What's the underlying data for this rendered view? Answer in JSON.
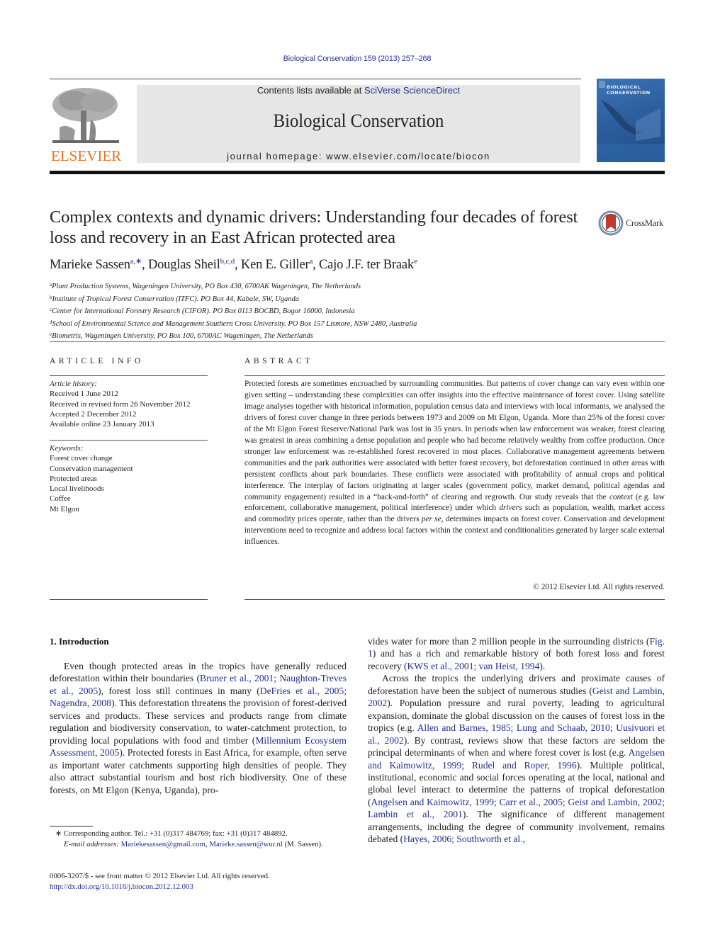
{
  "header": {
    "citation": "Biological Conservation 159 (2013) 257–268",
    "contents_prefix": "Contents lists available at ",
    "contents_link": "SciVerse ScienceDirect",
    "journal_name": "Biological Conservation",
    "homepage": "journal homepage: www.elsevier.com/locate/biocon",
    "publisher_logo": "ELSEVIER",
    "cover_title_line1": "BIOLOGICAL",
    "cover_title_line2": "CONSERVATION",
    "crossmark": "CrossMark"
  },
  "colors": {
    "link": "#1f2f8f",
    "elsevier_orange": "#e8731d",
    "banner_gray": "#e6e6e6",
    "cover_blue": "#2d5f9f",
    "crossmark_red": "#c0392b"
  },
  "article": {
    "title": "Complex contexts and dynamic drivers: Understanding four decades of forest loss and recovery in an East African protected area",
    "authors": [
      {
        "name": "Marieke Sassen",
        "sup": "a,∗"
      },
      {
        "name": "Douglas Sheil",
        "sup": "b,c,d"
      },
      {
        "name": "Ken E. Giller",
        "sup": "a"
      },
      {
        "name": "Cajo J.F. ter Braak",
        "sup": "e"
      }
    ],
    "affiliations": [
      {
        "key": "a",
        "text": "Plant Production Systems, Wageningen University, PO Box 430, 6700AK Wageningen, The Netherlands"
      },
      {
        "key": "b",
        "text": "Institute of Tropical Forest Conservation (ITFC). PO Box 44, Kabale, SW, Uganda"
      },
      {
        "key": "c",
        "text": "Center for International Forestry Research (CIFOR). PO Box 0113 BOCBD, Bogor 16000, Indonesia"
      },
      {
        "key": "d",
        "text": "School of Environmental Science and Management Southern Cross University. PO Box 157 Lismore, NSW 2480, Australia"
      },
      {
        "key": "e",
        "text": "Biometris, Wageningen University, PO Box 100, 6700AC Wageningen, The Netherlands"
      }
    ]
  },
  "article_info": {
    "heading": "ARTICLE INFO",
    "history_label": "Article history:",
    "history": [
      "Received 1 June 2012",
      "Received in revised form 26 November 2012",
      "Accepted 2 December 2012",
      "Available online 23 January 2013"
    ],
    "keywords_label": "Keywords:",
    "keywords": [
      "Forest cover change",
      "Conservation management",
      "Protected areas",
      "Local livelihoods",
      "Coffee",
      "Mt Elgon"
    ]
  },
  "abstract": {
    "heading": "ABSTRACT",
    "p1": "Protected forests are sometimes encroached by surrounding communities. But patterns of cover change can vary even within one given setting – understanding these complexities can offer insights into the effective maintenance of forest cover. Using satellite image analyses together with historical information, population census data and interviews with local informants, we analysed the drivers of forest cover change in three periods between 1973 and 2009 on Mt Elgon, Uganda. More than 25% of the forest cover of the Mt Elgon Forest Reserve/National Park was lost in 35 years. In periods when law enforcement was weaker, forest clearing was greatest in areas combining a dense population and people who had become relatively wealthy from coffee production. Once stronger law enforcement was re-established forest recovered in most places. Collaborative management agreements between communities and the park authorities were associated with better forest recovery, but deforestation continued in other areas with persistent conflicts about park boundaries. These conflicts were associated with profitability of annual crops and political interference. The interplay of factors originating at larger scales (government policy, market demand, political agendas and community engagement) resulted in a “back-and-forth” of clearing and regrowth. Our study reveals that the ",
    "em1": "context",
    "p2": " (e.g. law enforcement, collaborative management, political interference) under which ",
    "em2": "drivers",
    "p3": " such as population, wealth, market access and commodity prices operate, rather than the drivers ",
    "em3": "per se",
    "p4": ", determines impacts on forest cover. Conservation and development interventions need to recognize and address local factors within the context and conditionalities generated by larger scale external influences.",
    "copyright": "© 2012 Elsevier Ltd. All rights reserved."
  },
  "introduction": {
    "heading": "1. Introduction",
    "col1": [
      {
        "t": "Even though protected areas in the tropics have generally reduced deforestation within their boundaries ("
      },
      {
        "l": "Bruner et al., 2001; Naughton-Treves et al., 2005"
      },
      {
        "t": "), forest loss still continues in many ("
      },
      {
        "l": "DeFries et al., 2005; Nagendra, 2008"
      },
      {
        "t": "). This deforestation threatens the provision of forest-derived services and products. These services and products range from climate regulation and biodiversity conservation, to water-catchment protection, to providing local populations with food and timber ("
      },
      {
        "l": "Millennium Ecosystem Assessment, 2005"
      },
      {
        "t": "). Protected forests in East Africa, for example, often serve as important water catchments supporting high densities of people. They also attract substantial tourism and host rich biodiversity. One of these forests, on Mt Elgon (Kenya, Uganda), pro-"
      }
    ],
    "col2_p1": [
      {
        "t": "vides water for more than 2 million people in the surrounding districts ("
      },
      {
        "l": "Fig. 1"
      },
      {
        "t": ") and has a rich and remarkable history of both forest loss and forest recovery ("
      },
      {
        "l": "KWS et al., 2001; van Heist, 1994"
      },
      {
        "t": ")."
      }
    ],
    "col2_p2": [
      {
        "t": "Across the tropics the underlying drivers and proximate causes of deforestation have been the subject of numerous studies ("
      },
      {
        "l": "Geist and Lambin, 2002"
      },
      {
        "t": "). Population pressure and rural poverty, leading to agricultural expansion, dominate the global discussion on the causes of forest loss in the tropics (e.g. "
      },
      {
        "l": "Allen and Barnes, 1985; Lung and Schaab, 2010; Uusivuori et al., 2002"
      },
      {
        "t": "). By contrast, reviews show that these factors are seldom the principal determinants of when and where forest cover is lost (e.g. "
      },
      {
        "l": "Angelsen and Kaimowitz, 1999; Rudel and Roper, 1996"
      },
      {
        "t": "). Multiple political, institutional, economic and social forces operating at the local, national and global level interact to determine the patterns of tropical deforestation ("
      },
      {
        "l": "Angelsen and Kaimowitz, 1999; Carr et al., 2005; Geist and Lambin, 2002; Lambin et al., 2001"
      },
      {
        "t": "). The significance of different management arrangements, including the degree of community involvement, remains debated ("
      },
      {
        "l": "Hayes, 2006; Southworth et al.,"
      }
    ]
  },
  "footnote": {
    "marker": "∗",
    "corresponding": "Corresponding author. Tel.: +31 (0)317 484769; fax: +31 (0)317 484892.",
    "email_label": "E-mail addresses:",
    "email1": "Mariekesassen@gmail.com",
    "email2": "Marieke.sassen@wur.nl",
    "email_suffix": " (M. Sassen).",
    "front_matter": "0006-3207/$ - see front matter © 2012 Elsevier Ltd. All rights reserved.",
    "doi": "http://dx.doi.org/10.1016/j.biocon.2012.12.003"
  }
}
